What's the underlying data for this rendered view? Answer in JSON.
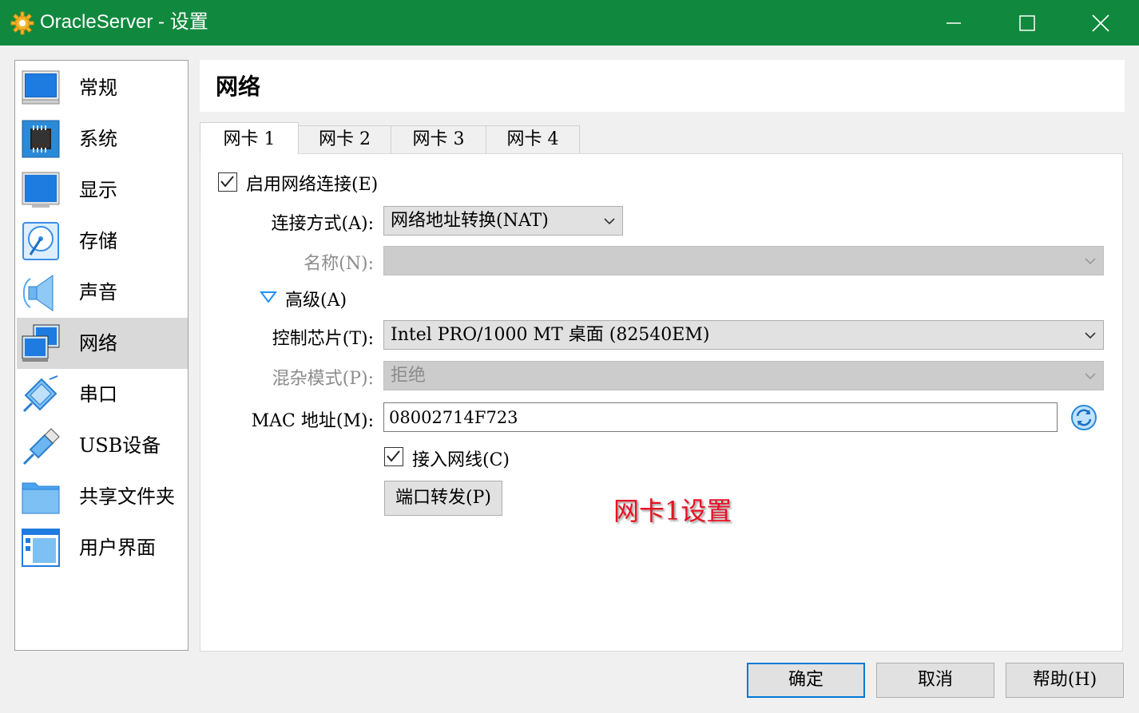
{
  "window": {
    "title": "OracleServer - 设置",
    "minimize_icon": "minimize-icon",
    "maximize_icon": "maximize-icon",
    "close_icon": "close-icon"
  },
  "sidebar": {
    "items": [
      {
        "label": "常规",
        "icon": "general-monitor-icon"
      },
      {
        "label": "系统",
        "icon": "system-chip-icon"
      },
      {
        "label": "显示",
        "icon": "display-monitor-icon"
      },
      {
        "label": "存储",
        "icon": "storage-disk-icon"
      },
      {
        "label": "声音",
        "icon": "audio-speaker-icon"
      },
      {
        "label": "网络",
        "icon": "network-icon",
        "selected": true
      },
      {
        "label": "串口",
        "icon": "serial-port-icon"
      },
      {
        "label": "USB设备",
        "icon": "usb-icon"
      },
      {
        "label": "共享文件夹",
        "icon": "shared-folder-icon"
      },
      {
        "label": "用户界面",
        "icon": "user-interface-icon"
      }
    ]
  },
  "page": {
    "title": "网络"
  },
  "tabs": [
    {
      "label": "网卡 1",
      "active": true
    },
    {
      "label": "网卡 2"
    },
    {
      "label": "网卡 3"
    },
    {
      "label": "网卡 4"
    }
  ],
  "adapter": {
    "enable_label": "启用网络连接(E)",
    "enable_checked": true,
    "attached_label": "连接方式(A):",
    "attached_value": "网络地址转换(NAT)",
    "name_label": "名称(N):",
    "name_value": "",
    "advanced_label": "高级(A)",
    "chip_label": "控制芯片(T):",
    "chip_value": "Intel PRO/1000 MT 桌面 (82540EM)",
    "promisc_label": "混杂模式(P):",
    "promisc_value": "拒绝",
    "mac_label": "MAC 地址(M):",
    "mac_value": "08002714F723",
    "cable_label": "接入网线(C)",
    "cable_checked": true,
    "port_forward_label": "端口转发(P)"
  },
  "annotation": "网卡1设置",
  "footer": {
    "ok_label": "确定",
    "cancel_label": "取消",
    "help_label": "帮助(H)"
  },
  "colors": {
    "titlebar": "#10893e",
    "accent": "#0078d7",
    "annotation": "#e81123"
  }
}
